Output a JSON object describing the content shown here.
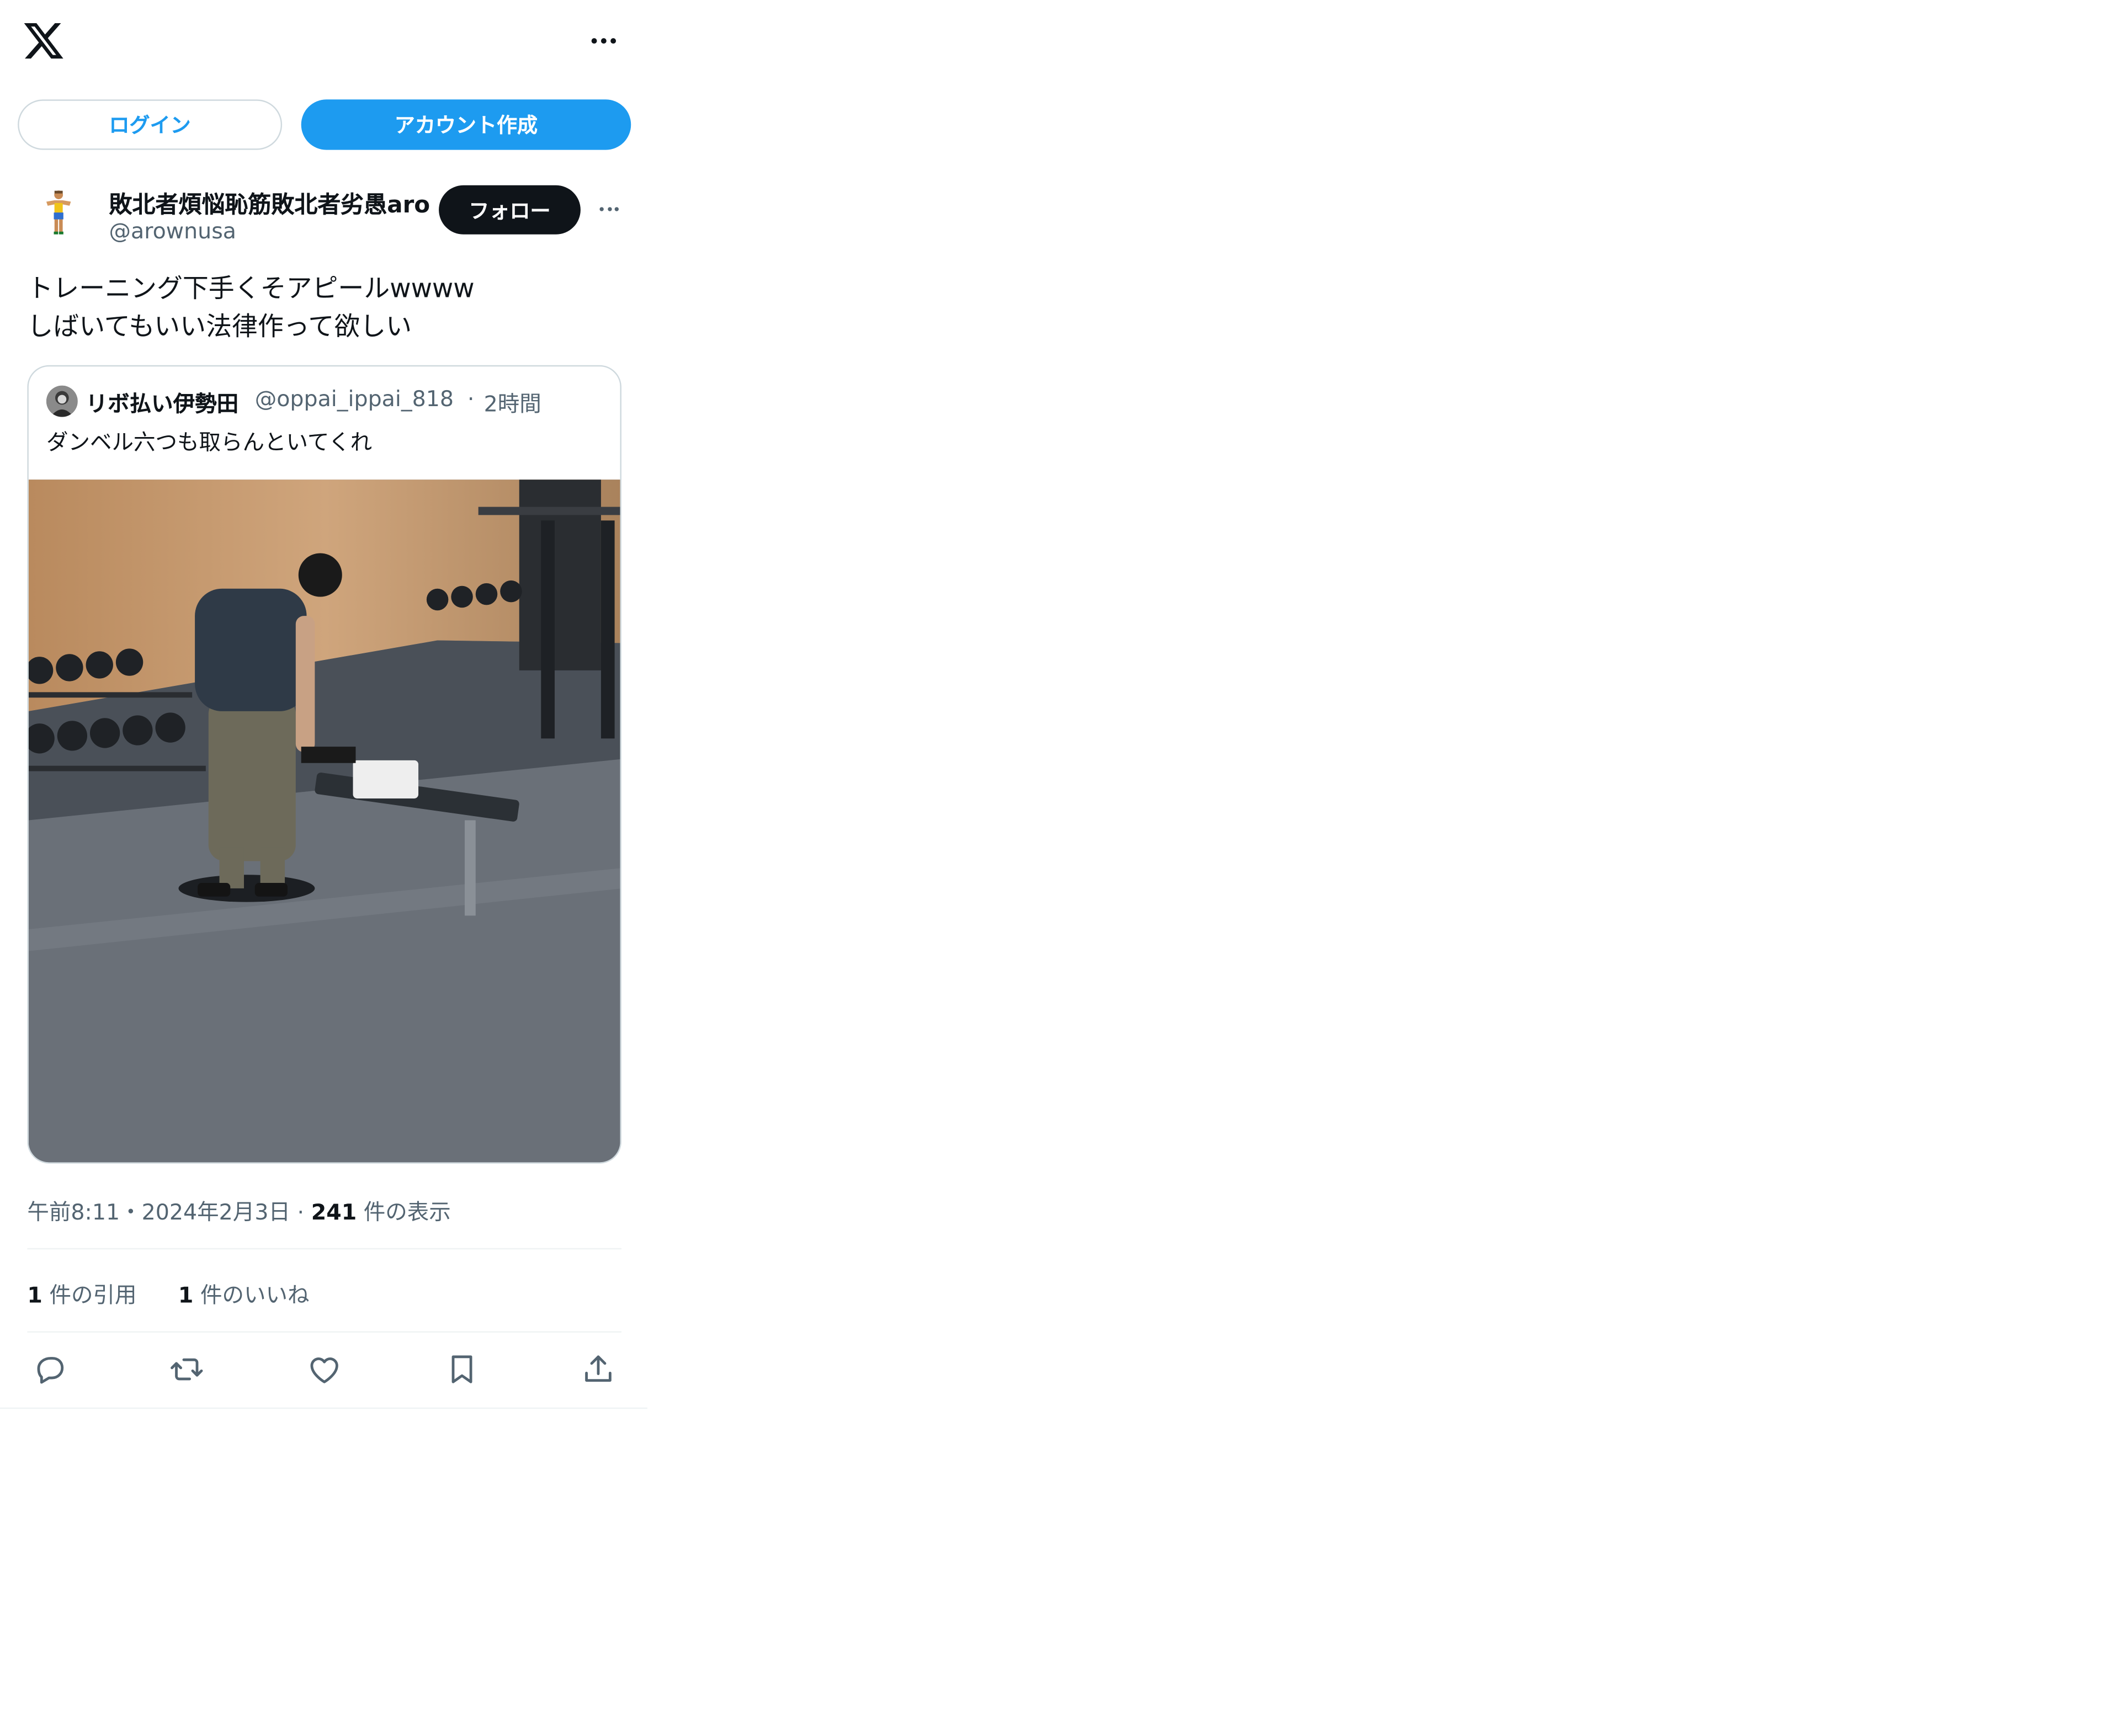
{
  "header": {
    "logo_icon": "x-logo-icon",
    "more_icon": "more-icon"
  },
  "auth": {
    "login_label": "ログイン",
    "signup_label": "アカウント作成"
  },
  "tweet": {
    "author_name": "敗北者煩悩恥筋敗北者劣愚aro",
    "author_handle": "@arownusa",
    "follow_label": "フォロー",
    "text_line1": "トレーニング下手くそアピールwwww",
    "text_line2": "しばいてもいい法律作って欲しい",
    "timestamp": "午前8:11・2024年2月3日",
    "separator": "·",
    "views_count": "241",
    "views_label": "件の表示",
    "quotes_count": "1",
    "quotes_label": "件の引用",
    "likes_count": "1",
    "likes_label": "件のいいね"
  },
  "quoted_tweet": {
    "author_name": "リボ払い伊勢田",
    "author_handle": "@oppai_ippai_818",
    "separator": "·",
    "time": "2時間",
    "text": "ダンベル六つも取らんといてくれ"
  },
  "actions": [
    "reply-icon",
    "retweet-icon",
    "like-icon",
    "bookmark-icon",
    "share-icon"
  ],
  "colors": {
    "accent": "#1d9bf0",
    "text": "#0f1419",
    "muted": "#536471",
    "border": "#cfd9de",
    "follow_bg": "#0f1419"
  }
}
